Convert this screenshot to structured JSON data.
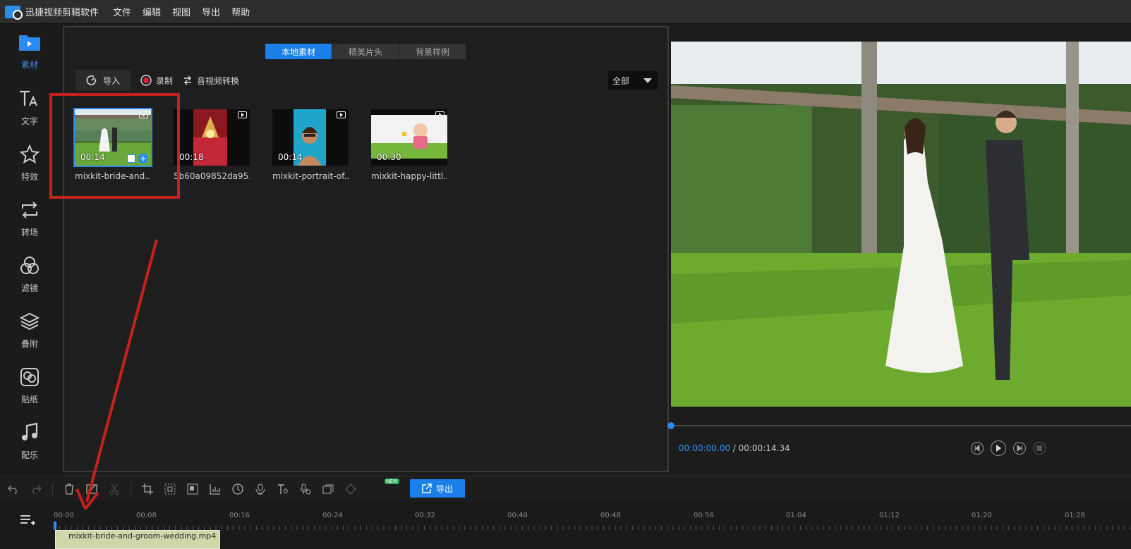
{
  "app": {
    "title": "迅捷视频剪辑软件"
  },
  "menu": [
    "文件",
    "编辑",
    "视图",
    "导出",
    "帮助"
  ],
  "sidebar": {
    "items": [
      {
        "label": "素材",
        "icon": "folder-play-icon",
        "active": true
      },
      {
        "label": "文字",
        "icon": "text-icon"
      },
      {
        "label": "特效",
        "icon": "sparkle-star-icon"
      },
      {
        "label": "转场",
        "icon": "transition-icon"
      },
      {
        "label": "滤镜",
        "icon": "filter-icon"
      },
      {
        "label": "叠附",
        "icon": "layers-icon"
      },
      {
        "label": "贴纸",
        "icon": "sticker-icon"
      },
      {
        "label": "配乐",
        "icon": "music-note-icon"
      }
    ]
  },
  "media": {
    "tabs": [
      {
        "label": "本地素材",
        "active": true
      },
      {
        "label": "精美片头"
      },
      {
        "label": "背景样例"
      }
    ],
    "import_label": "导入",
    "record_label": "录制",
    "convert_label": "音视频转换",
    "filter_value": "全部",
    "clips": [
      {
        "duration": "00:14",
        "name": "mixkit-bride-and...",
        "selected": true
      },
      {
        "duration": "00:18",
        "name": "5b60a09852da95..."
      },
      {
        "duration": "00:14",
        "name": "mixkit-portrait-of..."
      },
      {
        "duration": "00:30",
        "name": "mixkit-happy-littl..."
      }
    ]
  },
  "preview": {
    "current_time": "00:00:00.00",
    "separator": " / ",
    "total_time": "00:00:14.34",
    "progress": 0
  },
  "edit_toolbar": {
    "export_label": "导出",
    "new_badge": "NEW"
  },
  "timeline": {
    "ruler": [
      "00:00",
      "00:08",
      "00:16",
      "00:24",
      "00:32",
      "00:40",
      "00:48",
      "00:56",
      "01:04",
      "01:12",
      "01:20",
      "01:28"
    ],
    "clip_name": "mixkit-bride-and-groom-wedding.mp4"
  },
  "colors": {
    "accent": "#1a7fe8",
    "annotation": "#c4221a"
  }
}
